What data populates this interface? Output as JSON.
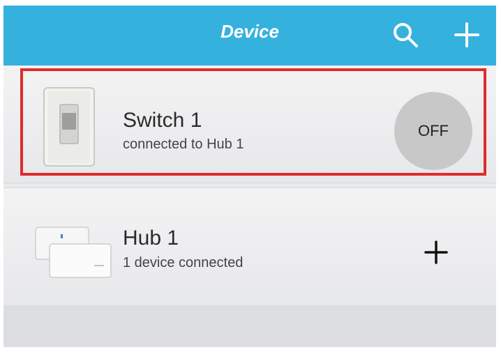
{
  "header": {
    "title": "Device",
    "search_icon": "search-icon",
    "add_icon": "plus-icon",
    "background_color": "#35b1dd"
  },
  "devices": [
    {
      "name": "Switch 1",
      "status": "connected to Hub 1",
      "icon": "light-switch-icon",
      "toggle_label": "OFF",
      "highlighted": true,
      "highlight_color": "#e02b2b"
    },
    {
      "name": "Hub 1",
      "status": "1 device connected",
      "icon": "hub-icon",
      "action_icon": "plus-icon"
    }
  ]
}
